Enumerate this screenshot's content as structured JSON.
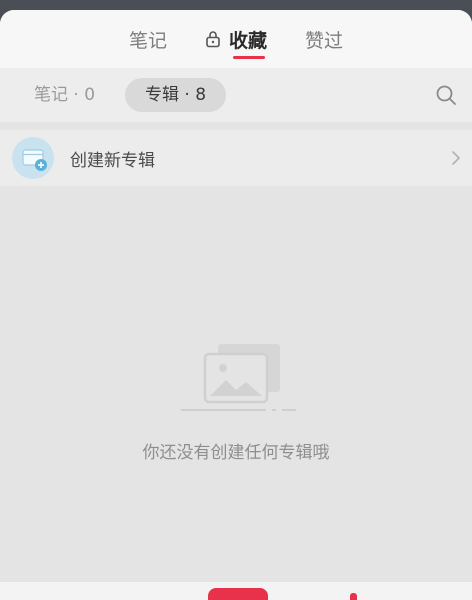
{
  "top_tabs": {
    "notes": "笔记",
    "favorites": "收藏",
    "liked": "赞过"
  },
  "sub_tabs": {
    "notes_label": "笔记 · 0",
    "albums_label": "专辑 · 8"
  },
  "create_album": {
    "label": "创建新专辑"
  },
  "empty_state": {
    "message": "你还没有创建任何专辑哦"
  },
  "colors": {
    "accent": "#e8324b",
    "icon_blue": "#bfe0f0",
    "icon_blue_dark": "#5ab0d8"
  },
  "icons": {
    "lock": "lock-icon",
    "search": "search-icon",
    "create": "album-add-icon",
    "chevron": "chevron-right-icon",
    "empty": "empty-album-illustration"
  }
}
